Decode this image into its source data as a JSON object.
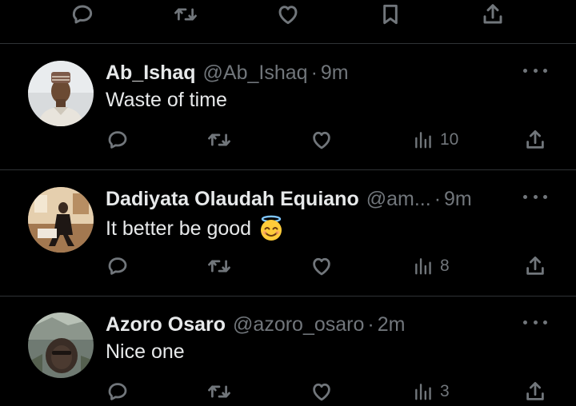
{
  "top_actions": {
    "icons": [
      "reply-icon",
      "retweet-icon",
      "like-icon",
      "bookmark-icon",
      "share-icon"
    ]
  },
  "replies": [
    {
      "name": "Ab_Ishaq",
      "handle": "@Ab_Ishaq",
      "dot": "·",
      "time": "9m",
      "text": "Waste of time",
      "views": "10",
      "emoji": ""
    },
    {
      "name": "Dadiyata Olaudah Equiano",
      "handle": "@am...",
      "dot": "·",
      "time": "9m",
      "text": "It better be good",
      "views": "8",
      "emoji": "smiling-face-with-halo"
    },
    {
      "name": "Azoro Osaro",
      "handle": "@azoro_osaro",
      "dot": "·",
      "time": "2m",
      "text": "Nice one",
      "views": "3",
      "emoji": ""
    }
  ],
  "colors": {
    "background": "#000000",
    "text": "#e7e9ea",
    "secondary": "#71767b",
    "divider": "#2f3336"
  }
}
